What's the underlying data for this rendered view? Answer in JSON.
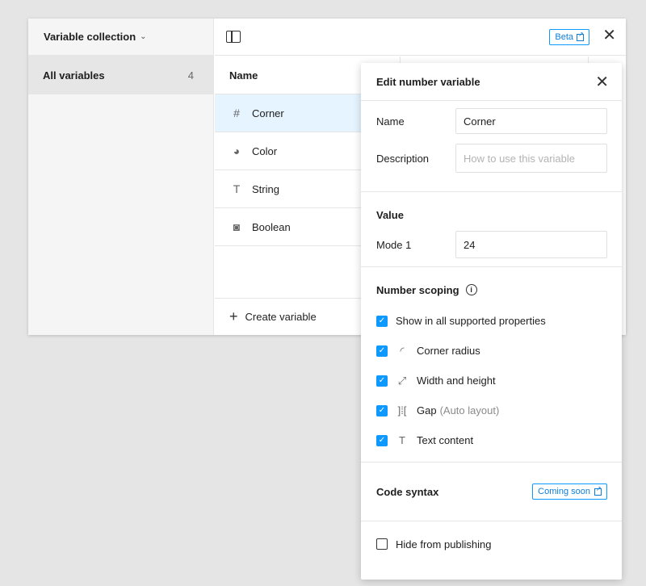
{
  "collection": {
    "title": "Variable collection",
    "all_label": "All variables",
    "count": "4"
  },
  "topbar": {
    "beta_label": "Beta"
  },
  "table": {
    "name_header": "Name",
    "rows": [
      {
        "icon": "#",
        "label": "Corner"
      },
      {
        "icon": "◕",
        "label": "Color"
      },
      {
        "icon": "T",
        "label": "String"
      },
      {
        "icon": "◙",
        "label": "Boolean"
      }
    ],
    "create_label": "Create variable"
  },
  "edit": {
    "title": "Edit number variable",
    "name_label": "Name",
    "name_value": "Corner",
    "description_label": "Description",
    "description_placeholder": "How to use this variable",
    "value_title": "Value",
    "mode_label": "Mode 1",
    "mode_value": "24",
    "scoping_title": "Number scoping",
    "scopes": {
      "show_all": "Show in all supported properties",
      "corner_radius": "Corner radius",
      "width_height": "Width and height",
      "gap": "Gap",
      "gap_note": "(Auto layout)",
      "text_content": "Text content"
    },
    "code_syntax_title": "Code syntax",
    "coming_soon": "Coming soon",
    "hide_publishing": "Hide from publishing"
  },
  "colors": {
    "accent": "#0d99ff",
    "selected_row": "#e5f4ff"
  }
}
